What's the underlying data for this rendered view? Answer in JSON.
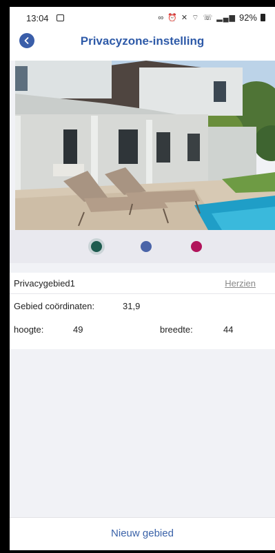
{
  "status_bar": {
    "time": "13:04",
    "icons": [
      "gallery-icon",
      "link-icon",
      "alarm-icon",
      "mute-icon",
      "wifi-icon",
      "wifi-call-icon",
      "signal-icon"
    ],
    "battery": "92%"
  },
  "header": {
    "back_icon": "chevron-left-icon",
    "title": "Privacyzone-instelling"
  },
  "photo": {
    "content": "house-with-pool-photo"
  },
  "zone_colors": {
    "options": [
      {
        "color": "#1e5b4f",
        "selected": true
      },
      {
        "color": "#4a64a8",
        "selected": false
      },
      {
        "color": "#b1145b",
        "selected": false
      }
    ]
  },
  "zone": {
    "name": "Privacygebied1",
    "edit_label": "Herzien",
    "coords_label": "Gebied coördinaten:",
    "coords_value": "31,9",
    "height_label": "hoogte:",
    "height_value": "49",
    "width_label": "breedte:",
    "width_value": "44"
  },
  "footer": {
    "new_area_label": "Nieuw gebied"
  },
  "colors": {
    "accent": "#2e5aa8",
    "background": "#f1f2f6"
  }
}
